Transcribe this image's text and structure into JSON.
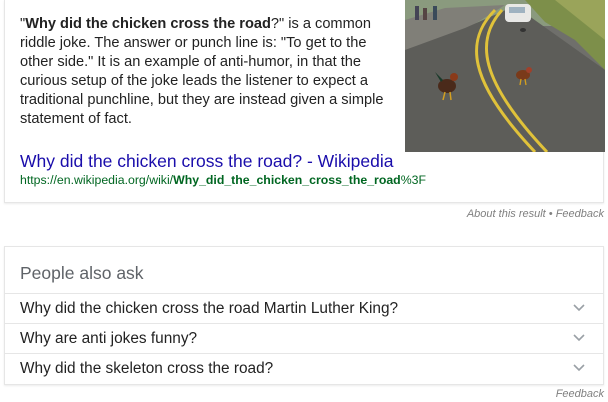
{
  "snippet": {
    "quote_open": "\"",
    "bold_question": "Why did the chicken cross the road",
    "after_bold": "?\" is a common riddle joke. The answer or punch line is: \"To get to the other side.\" It is an example of anti-humor, in that the curious setup of the joke leads the listener to expect a traditional punchline, but they are instead given a simple statement of fact.",
    "image_icon": "chickens-on-road-photo"
  },
  "result": {
    "title": "Why did the chicken cross the road? - Wikipedia",
    "url_prefix": "https://en.wikipedia.org/wiki/",
    "url_bold": "Why_did_the_chicken_cross_the_road",
    "url_suffix": "%3F"
  },
  "about": {
    "about_label": "About this result",
    "separator": " • ",
    "feedback_label": "Feedback"
  },
  "people_also_ask": {
    "heading": "People also ask",
    "questions": [
      "Why did the chicken cross the road Martin Luther King?",
      "Why are anti jokes funny?",
      "Why did the skeleton cross the road?"
    ]
  },
  "footer": {
    "feedback_label": "Feedback"
  },
  "colors": {
    "link_blue": "#1a0dab",
    "url_green": "#006621",
    "muted_gray": "#808080"
  }
}
